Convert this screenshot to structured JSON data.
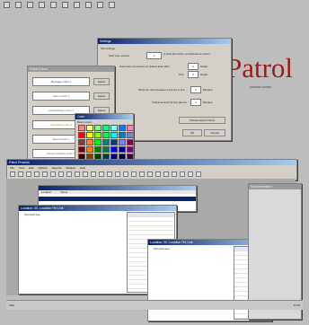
{
  "background": "#bdbdbd",
  "logo": {
    "text": "Patrol",
    "color": "#9b1b1b",
    "subtext": "process control"
  },
  "top_toolbar": {
    "icons": [
      "back-icon",
      "forward-icon",
      "search-icon",
      "print-icon",
      "cut-icon",
      "copy-icon",
      "paste-icon",
      "home-icon",
      "zoom-icon",
      "help-icon"
    ]
  },
  "settings_dialog": {
    "title": "Settings",
    "group_label": "Tab settings",
    "row1_label": "Start tree at level",
    "row1_value": "1",
    "row1_note": "(0 starts from outline, and all levels are shown)",
    "row2_label": "Automatic conversion of shared lines after",
    "row2_value": "3",
    "row2_unit": "Graph",
    "row3_label": "Unit",
    "row3_value": "3",
    "row3_unit": "Graph",
    "row4_label": "Minimum time between 2 events in line",
    "row4_value": "1",
    "row4_unit": "Minutes",
    "row5_label": "Tolerance limit for line alarms",
    "row5_value": "1",
    "row5_unit": "Minutes",
    "choose_button": "Choose Event Colors",
    "ok_button": "OK",
    "cancel_button": "Cancel"
  },
  "color_dialog": {
    "title": "Event Colors",
    "items": [
      {
        "label": "Message Color 1",
        "color": "#1f3fbf",
        "select": "Select"
      },
      {
        "label": "Alarm Color 1",
        "color": "#c0392b",
        "select": "Select"
      },
      {
        "label": "Acknowledge Color 1",
        "color": "#2e8b57",
        "select": "Select"
      },
      {
        "label": "Unit Active Color 1",
        "color": "#b8860b",
        "select": "Select"
      },
      {
        "label": "Event Color 1",
        "color": "#7a3a9a",
        "select": "Select"
      },
      {
        "label": "Recent Inactive Color 1",
        "color": "#c04040",
        "select": "Select"
      }
    ]
  },
  "palette_dialog": {
    "title": "Color",
    "label": "Basic colors:",
    "rows": [
      [
        "#ff8080",
        "#ffff80",
        "#80ff80",
        "#00ff80",
        "#80ffff",
        "#0080ff",
        "#ff80c0",
        "#ff80ff"
      ],
      [
        "#ff0000",
        "#ffff00",
        "#80ff00",
        "#00ff40",
        "#00ffff",
        "#0080c0",
        "#8080c0",
        "#ff00ff"
      ],
      [
        "#804040",
        "#ff8040",
        "#00ff00",
        "#008080",
        "#004080",
        "#8080ff",
        "#800040",
        "#ff0080"
      ],
      [
        "#800000",
        "#ff8000",
        "#008000",
        "#008040",
        "#0000ff",
        "#0000a0",
        "#800080",
        "#8000ff"
      ],
      [
        "#400000",
        "#804000",
        "#004000",
        "#004040",
        "#000080",
        "#000040",
        "#400040",
        "#400080"
      ],
      [
        "#000000",
        "#808000",
        "#808040",
        "#808080",
        "#408080",
        "#c0c0c0",
        "#400040",
        "#ffffff"
      ]
    ],
    "ok_button": "OK"
  },
  "main_app": {
    "title": "Patrol Process",
    "menu": [
      "File",
      "View",
      "Edit",
      "Options",
      "Reports",
      "Window",
      "Help"
    ]
  },
  "left_window": {
    "title": "Location: 00. Location Pld Unit",
    "tree_root": "Top level tree",
    "headers": [
      "Name",
      "Value",
      "Last"
    ]
  },
  "mid_window": {
    "header_cols": [
      "Location",
      "Name"
    ],
    "highlight_row": "selected"
  },
  "right_window": {
    "title": "Location: 00. Location Pld Unit",
    "tree_root": "Top level tree",
    "headers": [
      "Name",
      "Unit",
      "Last"
    ]
  },
  "far_right_panel": {
    "title": "Documentation"
  },
  "bottom_bar": {
    "left_label": "Start",
    "right_label": "12:00"
  }
}
